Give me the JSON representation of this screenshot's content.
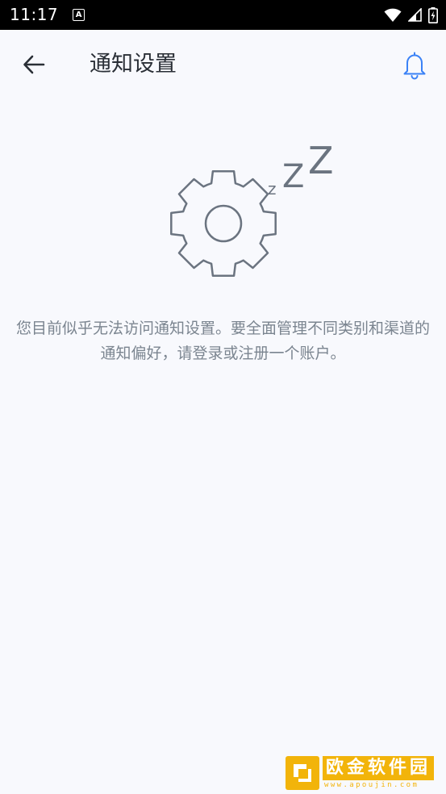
{
  "status_bar": {
    "time": "11:17",
    "notification_letter": "A",
    "icons": [
      "wifi-icon",
      "cellular-signal-icon",
      "battery-charging-icon"
    ]
  },
  "app_bar": {
    "back_icon": "arrow-left-icon",
    "title": "通知设置",
    "bell_icon": "bell-icon"
  },
  "empty_state": {
    "illustration": "sleeping-gear-icon",
    "sleep_letters": [
      "z",
      "Z",
      "Z"
    ],
    "message": "您目前似乎无法访问通知设置。要全面管理不同类别和渠道的通知偏好，请登录或注册一个账户。"
  },
  "watermark": {
    "name": "欧金软件园",
    "url": "www.apoujin.com"
  },
  "colors": {
    "background": "#f8f9fd",
    "status_bar": "#000000",
    "title_text": "#2a2f36",
    "body_text": "#7b8590",
    "accent_blue": "#3b82f6",
    "illustration_stroke": "#6b7480",
    "watermark": "#f2b40a"
  }
}
